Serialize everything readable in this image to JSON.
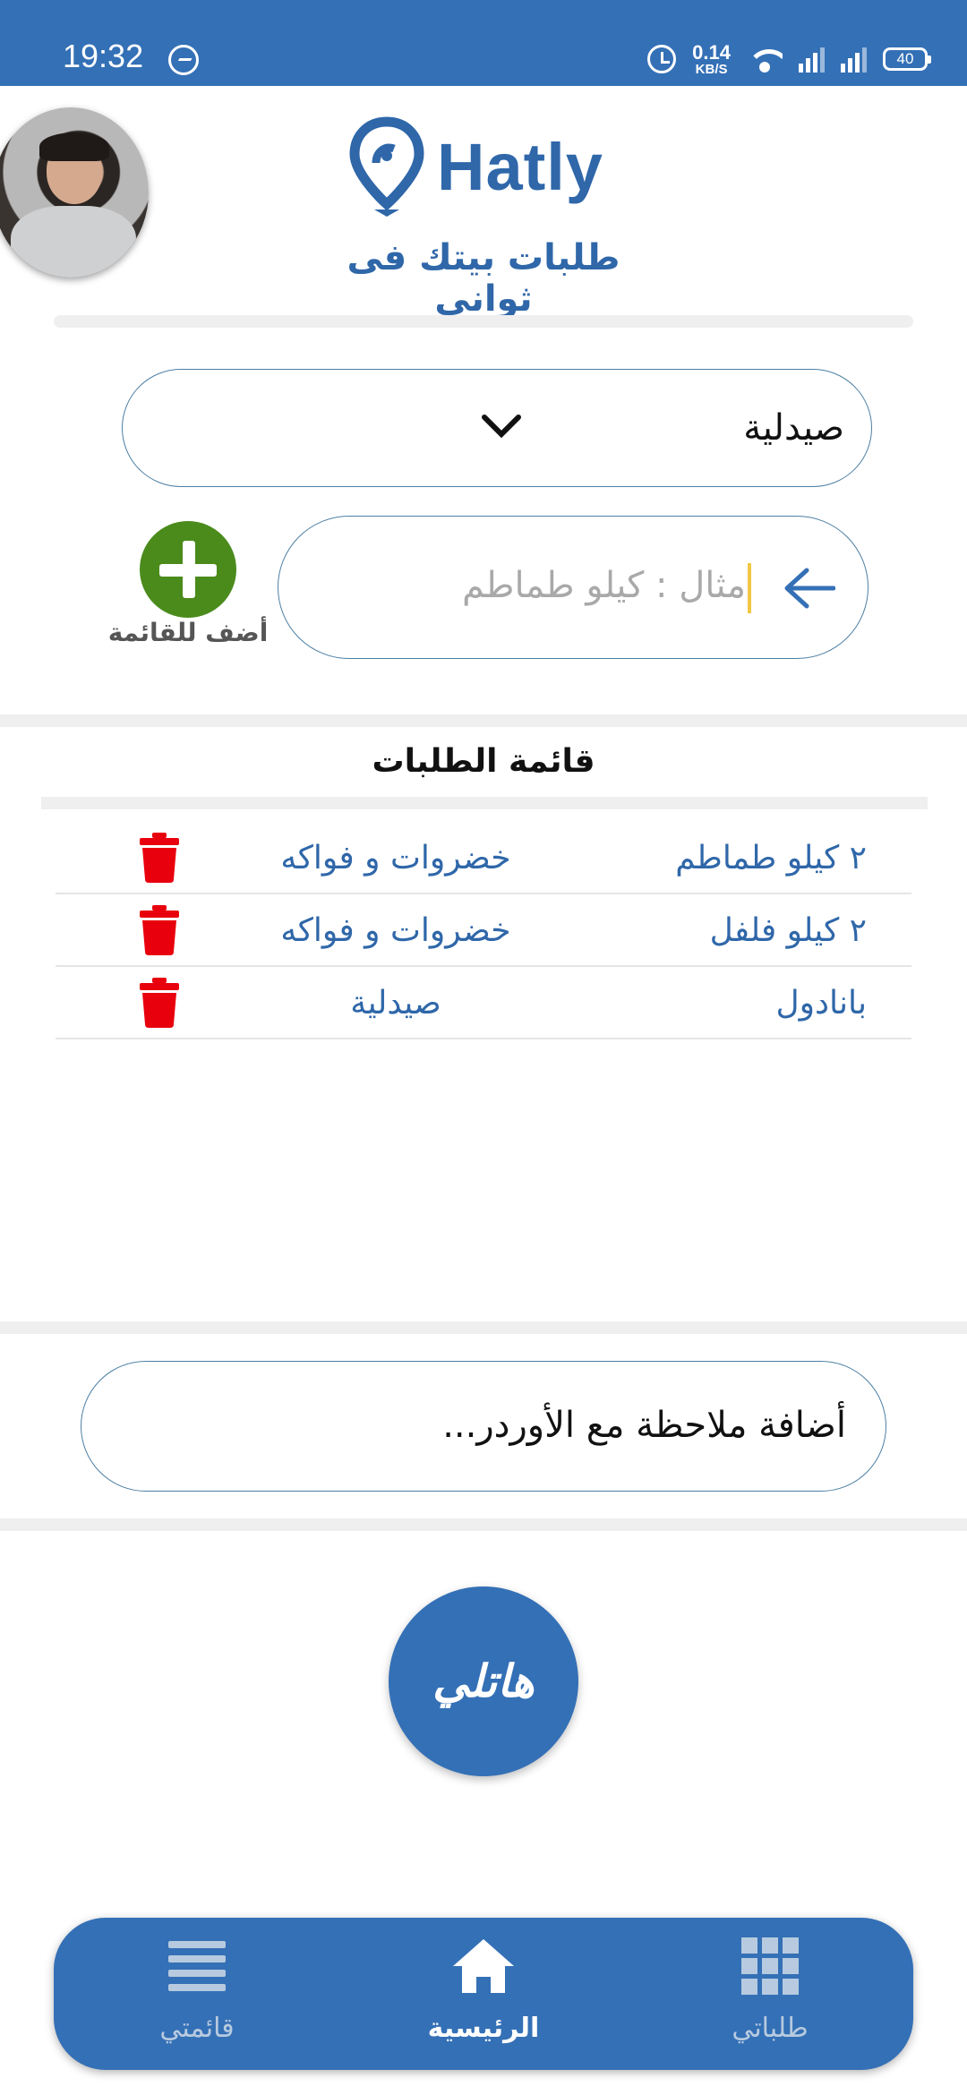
{
  "status_bar": {
    "time": "19:32",
    "net_speed_value": "0.14",
    "net_speed_unit": "KB/S",
    "battery": "40",
    "icons": [
      "messenger-icon",
      "alarm-icon",
      "wifi-icon",
      "signal-icon",
      "battery-icon"
    ]
  },
  "header": {
    "logo_text": "Hatly",
    "tagline": "طلبات بيتك فى ثوانى"
  },
  "form": {
    "category_value": "صيدلية",
    "item_placeholder": "مثال : كيلو طماطم",
    "add_label": "أضف للقائمة"
  },
  "orders": {
    "title": "قائمة الطلبات",
    "rows": [
      {
        "item": "٢ كيلو طماطم",
        "category": "خضروات و فواكه"
      },
      {
        "item": "٢ كيلو فلفل",
        "category": "خضروات و فواكه"
      },
      {
        "item": "بانادول",
        "category": "صيدلية"
      }
    ]
  },
  "note": {
    "placeholder": "أضافة ملاحظة مع الأوردر..."
  },
  "main_button": {
    "label": "هاتلي"
  },
  "bottom_nav": {
    "my_list": "قائمتي",
    "home": "الرئيسية",
    "my_orders": "طلباتي"
  },
  "colors": {
    "primary": "#3470b6",
    "add_green": "#4b8b1c",
    "delete_red": "#e8000d",
    "caret": "#f2c744"
  }
}
